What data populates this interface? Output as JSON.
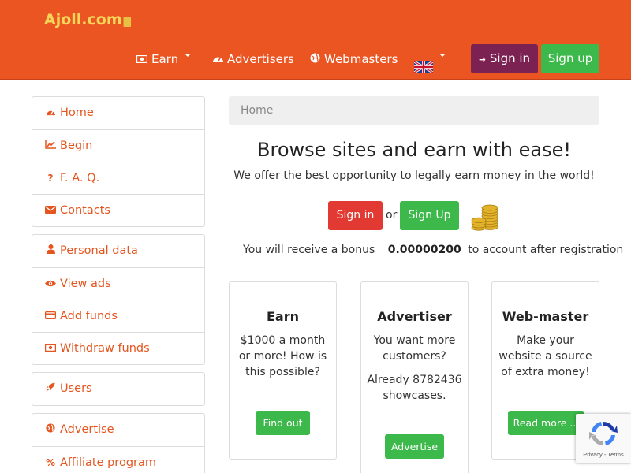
{
  "header": {
    "logo": "Ajoll.com",
    "nav": [
      {
        "label": "Earn",
        "icon": "money-icon",
        "dropdown": true
      },
      {
        "label": "Advertisers",
        "icon": "dashboard-icon",
        "dropdown": false
      },
      {
        "label": "Webmasters",
        "icon": "globe-icon",
        "dropdown": false
      }
    ],
    "language_flag": "uk-flag-icon",
    "signin_label": "Sign in",
    "signup_label": "Sign up"
  },
  "sidebar": {
    "groups": [
      [
        {
          "label": "Home",
          "icon": "dashboard-icon"
        },
        {
          "label": "Begin",
          "icon": "line-chart-icon"
        },
        {
          "label": "F. A. Q.",
          "icon": "question-icon"
        },
        {
          "label": "Contacts",
          "icon": "envelope-icon"
        }
      ],
      [
        {
          "label": "Personal data",
          "icon": "user-icon"
        },
        {
          "label": "View ads",
          "icon": "eye-icon"
        },
        {
          "label": "Add funds",
          "icon": "credit-card-icon"
        },
        {
          "label": "Withdraw funds",
          "icon": "money-icon"
        }
      ],
      [
        {
          "label": "Users",
          "icon": "rocket-icon"
        }
      ],
      [
        {
          "label": "Advertise",
          "icon": "globe-icon"
        },
        {
          "label": "Affiliate program",
          "icon": "percent-icon"
        }
      ]
    ]
  },
  "main": {
    "breadcrumb": "Home",
    "title": "Browse sites and earn with ease!",
    "subtitle": "We offer the best opportunity to legally earn money in the world!",
    "signin_label": "Sign in",
    "or_text": "or",
    "signup_label": "Sign Up",
    "bonus_prefix": "You will receive a bonus",
    "bonus_amount": "0.00000200",
    "bonus_suffix": "to account after registration",
    "cards": [
      {
        "title": "Earn",
        "paragraphs": [
          "$1000 a month or more! How is this possible?"
        ],
        "button": "Find out"
      },
      {
        "title": "Advertiser",
        "paragraphs": [
          "You want more customers?",
          "Already 8782436 showcases."
        ],
        "button": "Advertise"
      },
      {
        "title": "Web-master",
        "paragraphs": [
          "Make your website a source of extra money!"
        ],
        "button": "Read more ..."
      }
    ]
  },
  "recaptcha": {
    "privacy": "Privacy",
    "separator": " - ",
    "terms": "Terms"
  },
  "colors": {
    "brand_orange": "#ea5522",
    "signin_purple": "#7c2252",
    "green": "#3db84a",
    "red": "#e23a32",
    "link_orange": "#e4551f"
  }
}
